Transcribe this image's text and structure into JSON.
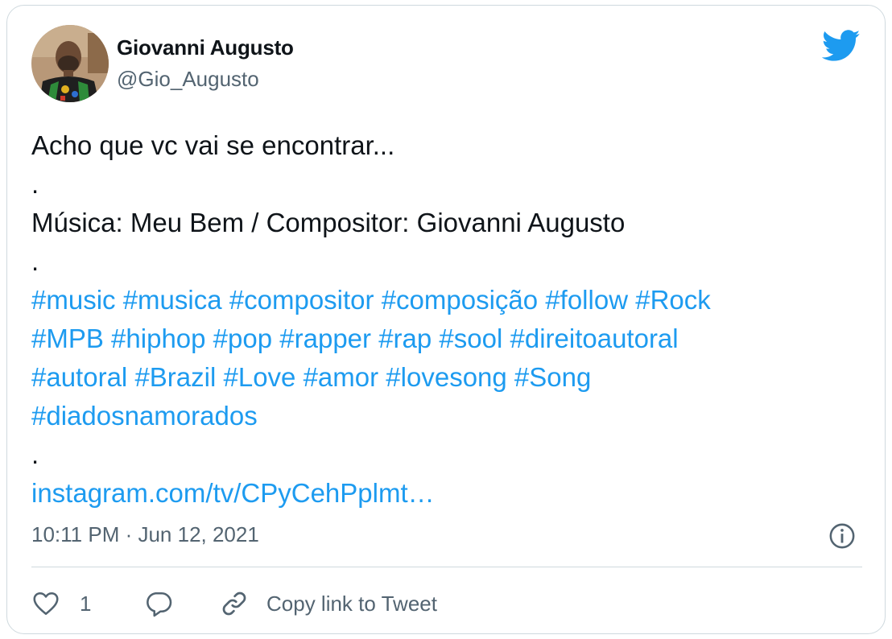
{
  "author": {
    "name": "Giovanni Augusto",
    "handle": "@Gio_Augusto"
  },
  "tweet": {
    "line1": "Acho que vc vai se encontrar...",
    "dot1": ".",
    "line2": "Música: Meu Bem / Compositor: Giovanni Augusto",
    "dot2": ".",
    "hashtag_lines": [
      [
        "#music",
        "#musica",
        "#compositor",
        "#composição",
        "#follow",
        "#Rock"
      ],
      [
        "#MPB",
        "#hiphop",
        "#pop",
        "#rapper",
        "#rap",
        "#sool",
        "#direitoautoral"
      ],
      [
        "#autoral",
        " #Brazil",
        "#Love",
        "#amor",
        "#lovesong",
        "#Song"
      ],
      [
        "#diadosnamorados"
      ]
    ],
    "dot3": ".",
    "link": "instagram.com/tv/CPyCehPplmt…"
  },
  "timestamp": "10:11 PM · Jun 12, 2021",
  "actions": {
    "like_count": "1",
    "copy_link_label": "Copy link to Tweet"
  },
  "colors": {
    "accent": "#1d9bf0",
    "muted": "#536471",
    "border": "#cfd9de"
  },
  "icons": [
    "twitter-bird-icon",
    "info-icon",
    "heart-icon",
    "reply-icon",
    "link-icon"
  ]
}
